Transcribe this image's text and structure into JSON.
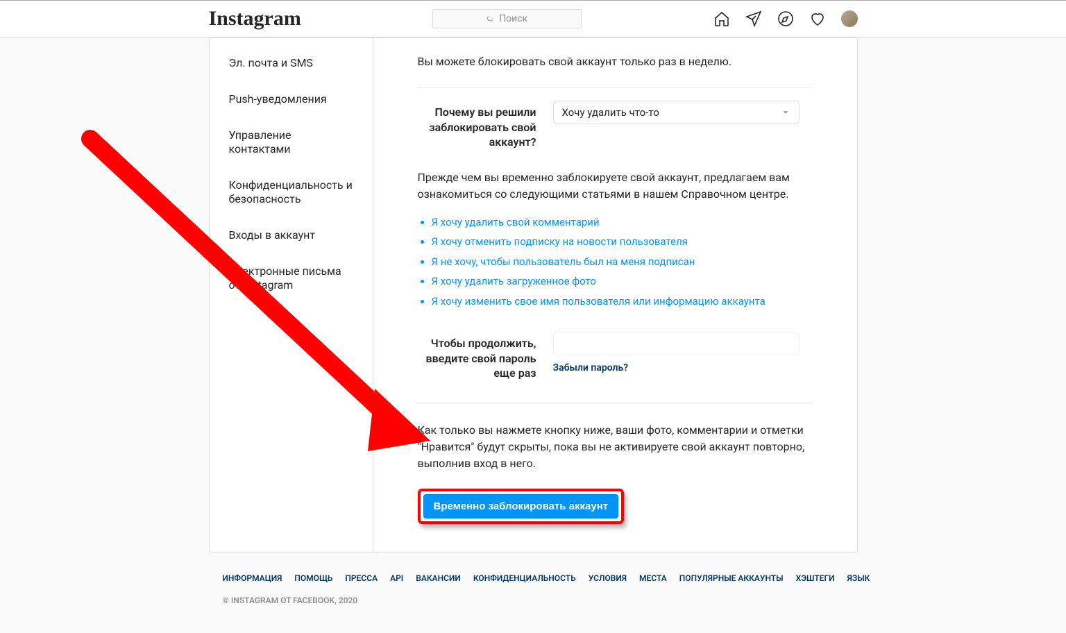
{
  "header": {
    "logo": "Instagram",
    "search_placeholder": "Поиск"
  },
  "sidebar": {
    "items": [
      {
        "label": "Эл. почта и SMS"
      },
      {
        "label": "Push-уведомления"
      },
      {
        "label": "Управление контактами"
      },
      {
        "label": "Конфиденциальность и безопасность"
      },
      {
        "label": "Входы в аккаунт"
      },
      {
        "label": "Электронные письма от Instagram"
      }
    ]
  },
  "main": {
    "limit_text": "Вы можете блокировать свой аккаунт только раз в неделю.",
    "reason_label": "Почему вы решили заблокировать свой аккаунт?",
    "reason_selected": "Хочу удалить что-то",
    "help_intro": "Прежде чем вы временно заблокируете свой аккаунт, предлагаем вам ознакомиться со следующими статьями в нашем Справочном центре.",
    "help_links": [
      "Я хочу удалить свой комментарий",
      "Я хочу отменить подписку на новости пользователя",
      "Я не хочу, чтобы пользователь был на меня подписан",
      "Я хочу удалить загруженное фото",
      "Я хочу изменить свое имя пользователя или информацию аккаунта"
    ],
    "password_label": "Чтобы продолжить, введите свой пароль еще раз",
    "forgot_password": "Забыли пароль?",
    "final_text": "Как только вы нажмете кнопку ниже, ваши фото, комментарии и отметки \"Нравится\" будут скрыты, пока вы не активируете свой аккаунт повторно, выполнив вход в него.",
    "submit_button": "Временно заблокировать аккаунт"
  },
  "footer": {
    "links": [
      "Информация",
      "Помощь",
      "Пресса",
      "API",
      "Вакансии",
      "Конфиденциальность",
      "Условия",
      "Места",
      "Популярные аккаунты",
      "Хэштеги",
      "Язык"
    ],
    "copyright": "© Instagram от Facebook, 2020"
  }
}
